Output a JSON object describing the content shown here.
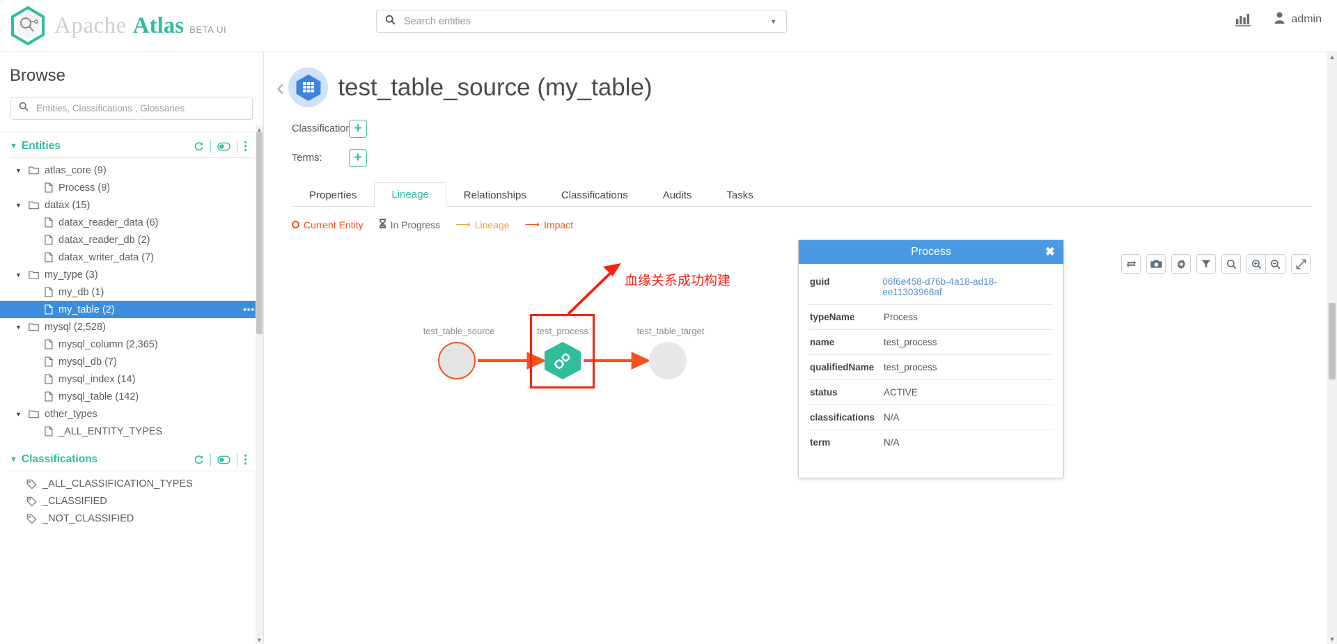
{
  "header": {
    "brand": {
      "apache": "Apache",
      "atlas": "Atlas",
      "beta": "BETA UI",
      "logo_icon": "atlas-hex-logo-icon"
    },
    "search": {
      "placeholder": "Search entities",
      "value": "",
      "icon": "search-icon",
      "caret_icon": "chevron-down-icon"
    },
    "stats_icon": "statistics-chart-icon",
    "user": {
      "label": "admin",
      "icon": "user-icon"
    }
  },
  "sidebar": {
    "title": "Browse",
    "search": {
      "placeholder": "Entities, Classifications , Glossaries",
      "value": "",
      "icon": "search-icon"
    },
    "entities_section": {
      "title": "Entities",
      "caret_icon": "chevron-down-icon",
      "actions": [
        {
          "name": "refresh-icon",
          "glyph": "↻"
        },
        {
          "name": "toggle-icon",
          "glyph": "◐"
        },
        {
          "name": "more-vertical-icon",
          "glyph": "⋮"
        }
      ],
      "tree": [
        {
          "label": "atlas_core (9)",
          "level": 1,
          "type": "folder",
          "expanded": true
        },
        {
          "label": "Process (9)",
          "level": 2,
          "type": "file"
        },
        {
          "label": "datax (15)",
          "level": 1,
          "type": "folder",
          "expanded": true
        },
        {
          "label": "datax_reader_data (6)",
          "level": 2,
          "type": "file"
        },
        {
          "label": "datax_reader_db (2)",
          "level": 2,
          "type": "file"
        },
        {
          "label": "datax_writer_data (7)",
          "level": 2,
          "type": "file"
        },
        {
          "label": "my_type (3)",
          "level": 1,
          "type": "folder",
          "expanded": true
        },
        {
          "label": "my_db (1)",
          "level": 2,
          "type": "file"
        },
        {
          "label": "my_table (2)",
          "level": 2,
          "type": "file",
          "selected": true
        },
        {
          "label": "mysql (2,528)",
          "level": 1,
          "type": "folder",
          "expanded": true
        },
        {
          "label": "mysql_column (2,365)",
          "level": 2,
          "type": "file"
        },
        {
          "label": "mysql_db (7)",
          "level": 2,
          "type": "file"
        },
        {
          "label": "mysql_index (14)",
          "level": 2,
          "type": "file"
        },
        {
          "label": "mysql_table (142)",
          "level": 2,
          "type": "file"
        },
        {
          "label": "other_types",
          "level": 1,
          "type": "folder",
          "expanded": true
        },
        {
          "label": "_ALL_ENTITY_TYPES",
          "level": 2,
          "type": "file"
        }
      ]
    },
    "classifications_section": {
      "title": "Classifications",
      "caret_icon": "chevron-down-icon",
      "actions": [
        {
          "name": "refresh-icon",
          "glyph": "↻"
        },
        {
          "name": "toggle-icon",
          "glyph": "◐"
        },
        {
          "name": "more-vertical-icon",
          "glyph": "⋮"
        }
      ],
      "items": [
        {
          "label": "_ALL_CLASSIFICATION_TYPES",
          "type": "tag"
        },
        {
          "label": "_CLASSIFIED",
          "type": "tag"
        },
        {
          "label": "_NOT_CLASSIFIED",
          "type": "tag"
        }
      ]
    }
  },
  "entity": {
    "back_icon": "chevron-left-icon",
    "type_icon": "table-hex-icon",
    "title": "test_table_source (my_table)",
    "classifications_label": "Classifications:",
    "classifications_add": "+",
    "terms_label": "Terms:",
    "terms_add": "+"
  },
  "tabs": [
    {
      "label": "Properties",
      "active": false
    },
    {
      "label": "Lineage",
      "active": true
    },
    {
      "label": "Relationships",
      "active": false
    },
    {
      "label": "Classifications",
      "active": false
    },
    {
      "label": "Audits",
      "active": false
    },
    {
      "label": "Tasks",
      "active": false
    }
  ],
  "lineage": {
    "legend": [
      {
        "label": "Current Entity",
        "icon": "ring-icon",
        "color": "#f4511e"
      },
      {
        "label": "In Progress",
        "icon": "hourglass-icon",
        "color": "#666666"
      },
      {
        "label": "Lineage",
        "icon": "arrow-right-icon",
        "color": "#e8a33d"
      },
      {
        "label": "Impact",
        "icon": "arrow-right-icon",
        "color": "#f4511e"
      }
    ],
    "toolbar": [
      {
        "name": "swap-lineage-icon",
        "glyph": "⇄"
      },
      {
        "name": "camera-screenshot-icon",
        "glyph": "camera"
      },
      {
        "name": "gear-settings-icon",
        "glyph": "gear"
      },
      {
        "name": "filter-icon",
        "glyph": "filter"
      },
      {
        "name": "search-icon",
        "glyph": "search"
      },
      {
        "name": "zoom-in-icon",
        "glyph": "zoom-in"
      },
      {
        "name": "zoom-out-icon",
        "glyph": "zoom-out"
      },
      {
        "name": "fullscreen-icon",
        "glyph": "expand"
      }
    ],
    "nodes": [
      {
        "label": "test_table_source",
        "kind": "circle",
        "current": true
      },
      {
        "label": "test_process",
        "kind": "hexagon",
        "highlighted": true
      },
      {
        "label": "test_table_target",
        "kind": "circle",
        "current": false
      }
    ],
    "annotation": "血缘关系成功构建",
    "annotation_color": "#f4240f"
  },
  "process_panel": {
    "title": "Process",
    "close_icon": "close-icon",
    "rows": [
      {
        "key": "guid",
        "value": "06f6e458-d76b-4a18-ad18-ee11303968af",
        "is_link": true
      },
      {
        "key": "typeName",
        "value": "Process",
        "is_link": false
      },
      {
        "key": "name",
        "value": "test_process",
        "is_link": false
      },
      {
        "key": "qualifiedName",
        "value": "test_process",
        "is_link": false
      },
      {
        "key": "status",
        "value": "ACTIVE",
        "is_link": false
      },
      {
        "key": "classifications",
        "value": "N/A",
        "is_link": false
      },
      {
        "key": "term",
        "value": "N/A",
        "is_link": false
      }
    ]
  },
  "colors": {
    "brand_green": "#2fbea0",
    "selected_blue": "#3c8dde",
    "panel_blue": "#4a9ae3",
    "annotation_red": "#f4240f",
    "lineage_orange": "#f4511e"
  }
}
